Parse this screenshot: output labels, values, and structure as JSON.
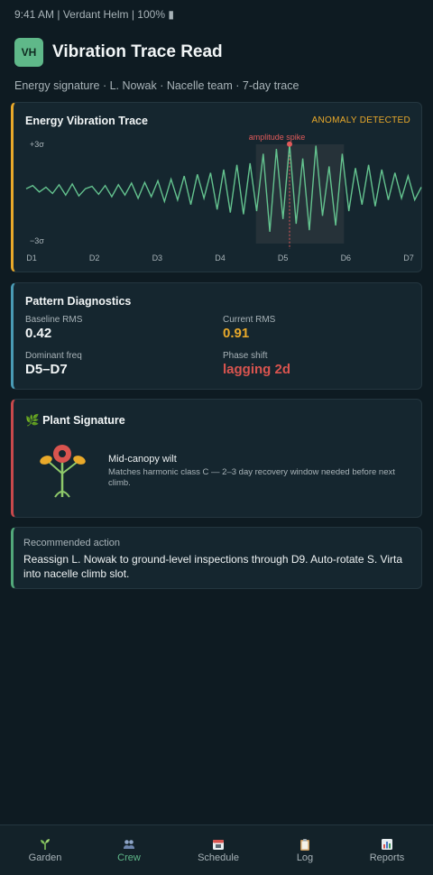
{
  "status_bar": {
    "text": "9:41 AM | Verdant Helm | 100% ▮"
  },
  "header": {
    "avatar": "VH",
    "title": "Vibration Trace Read"
  },
  "subtitle": "Energy signature · L. Nowak · Nacelle team · 7-day trace",
  "trace": {
    "title": "Energy Vibration Trace",
    "badge": "ANOMALY DETECTED",
    "colors": {
      "line": "#64c38f",
      "spike": "#e05a5a",
      "badge": "#e9a92a"
    },
    "chart_data": {
      "type": "line",
      "x_ticks": [
        "D1",
        "D2",
        "D3",
        "D4",
        "D5",
        "D6",
        "D7"
      ],
      "y_labels": [
        "+3σ",
        "−3σ"
      ],
      "ylim": [
        -3,
        3
      ],
      "values": [
        0.1,
        0.3,
        -0.1,
        0.2,
        -0.2,
        0.35,
        -0.3,
        0.4,
        -0.35,
        0.1,
        0.25,
        -0.25,
        0.3,
        -0.4,
        0.35,
        -0.3,
        0.45,
        -0.5,
        0.5,
        -0.4,
        0.6,
        -0.7,
        0.7,
        -0.6,
        0.9,
        -0.9,
        1.0,
        -0.5,
        1.1,
        -1.2,
        1.3,
        -1.4,
        1.6,
        -1.5,
        1.7,
        -1.3,
        2.3,
        -2.6,
        2.6,
        -1.8,
        2.9,
        -2.1,
        2.0,
        -2.5,
        2.8,
        -1.6,
        1.5,
        -2.2,
        2.3,
        -1.3,
        1.4,
        -0.9,
        1.6,
        -1.0,
        1.3,
        -0.6,
        1.1,
        -0.5,
        0.9,
        -0.6,
        0.2
      ],
      "highlight_range": [
        "D5",
        "D6"
      ],
      "annotation": {
        "label": "amplitude spike",
        "x_index": 40,
        "value": 2.9
      }
    }
  },
  "diagnostics": {
    "title": "Pattern Diagnostics",
    "metrics": [
      {
        "label": "Baseline RMS",
        "value": "0.42",
        "color": "#f2f6f7"
      },
      {
        "label": "Current RMS",
        "value": "0.91",
        "color": "#e9a92a"
      },
      {
        "label": "Dominant freq",
        "value": "D5–D7",
        "color": "#f2f6f7"
      },
      {
        "label": "Phase shift",
        "value": "lagging 2d",
        "color": "#d9544f"
      }
    ]
  },
  "plant": {
    "icon": "🌿",
    "title": "Plant Signature",
    "name": "Mid-canopy wilt",
    "description": "Matches harmonic class C — 2–3 day recovery window needed before next climb.",
    "colors": {
      "stem": "#8ec96a",
      "leaf": "#e9a92a",
      "flower": "#d9544f"
    }
  },
  "action": {
    "label": "Recommended action",
    "text": "Reassign L. Nowak to ground-level inspections through D9. Auto-rotate S. Virta into nacelle climb slot."
  },
  "tabs": [
    {
      "label": "Garden",
      "icon": "seedling-icon",
      "active": false
    },
    {
      "label": "Crew",
      "icon": "people-icon",
      "active": true
    },
    {
      "label": "Schedule",
      "icon": "calendar-icon",
      "active": false
    },
    {
      "label": "Log",
      "icon": "clipboard-icon",
      "active": false
    },
    {
      "label": "Reports",
      "icon": "bar-chart-icon",
      "active": false
    }
  ]
}
